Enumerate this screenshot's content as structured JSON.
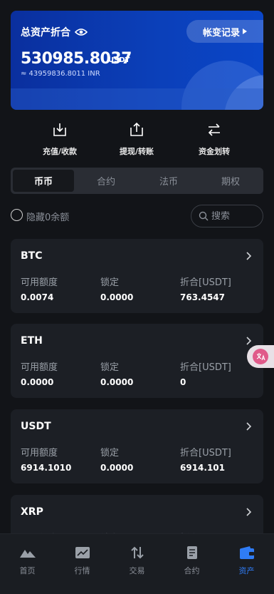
{
  "banner": {
    "title": "总资产折合",
    "record_button": "帐变记录",
    "amount": "530985.8037",
    "unit": "USDT",
    "inr": "≈ 43959836.8011 INR"
  },
  "actions": [
    {
      "label": "充值/收款",
      "icon": "download-icon"
    },
    {
      "label": "提现/转账",
      "icon": "upload-icon"
    },
    {
      "label": "资金划转",
      "icon": "transfer-icon"
    }
  ],
  "tabs": [
    {
      "label": "币币",
      "active": true
    },
    {
      "label": "合约",
      "active": false
    },
    {
      "label": "法币",
      "active": false
    },
    {
      "label": "期权",
      "active": false
    }
  ],
  "filter": {
    "hide_zero_label": "隐藏0余额",
    "search_placeholder": "搜索"
  },
  "columns": {
    "available": "可用额度",
    "locked": "锁定",
    "converted": "折合[USDT]"
  },
  "assets": [
    {
      "name": "BTC",
      "available": "0.0074",
      "locked": "0.0000",
      "converted": "763.4547"
    },
    {
      "name": "ETH",
      "available": "0.0000",
      "locked": "0.0000",
      "converted": "0"
    },
    {
      "name": "USDT",
      "available": "6914.1010",
      "locked": "0.0000",
      "converted": "6914.101"
    },
    {
      "name": "XRP",
      "available": "",
      "locked": "",
      "converted": ""
    }
  ],
  "float_badge": {
    "icon": "translate-icon"
  },
  "bottom_nav": [
    {
      "label": "首页",
      "icon": "home-mountain-icon",
      "active": false
    },
    {
      "label": "行情",
      "icon": "chart-icon",
      "active": false
    },
    {
      "label": "交易",
      "icon": "trade-arrows-icon",
      "active": false
    },
    {
      "label": "合约",
      "icon": "contract-icon",
      "active": false
    },
    {
      "label": "资产",
      "icon": "wallet-icon",
      "active": true
    }
  ],
  "colors": {
    "accent": "#2f7cf6",
    "banner": "#0b3fb8",
    "background": "#121418"
  }
}
